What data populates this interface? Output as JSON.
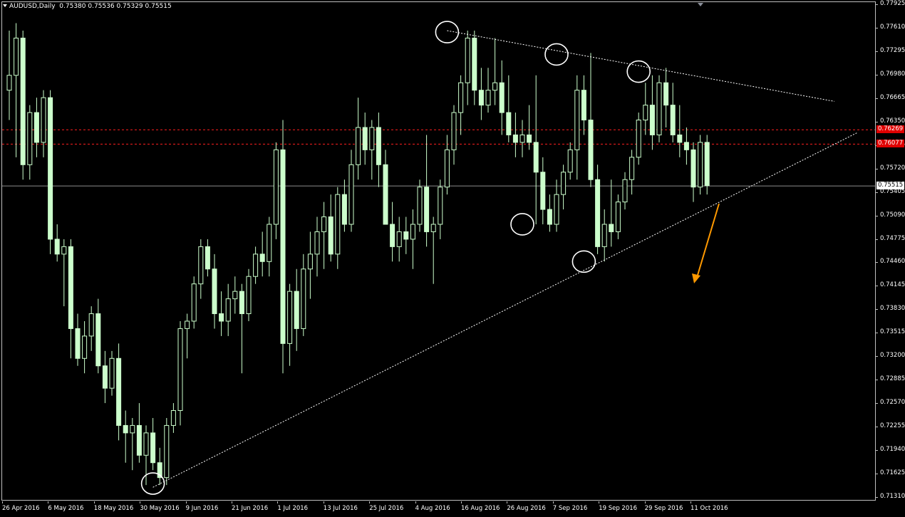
{
  "header": {
    "symbol": "AUDUSD,Daily",
    "ohlc": "0.75380 0.75536 0.75329 0.75515"
  },
  "colors": {
    "background": "#000000",
    "bull_candle": "#000000",
    "candle_outline": "#ccffcc",
    "current_price_line": "#8c8c8c",
    "resistance_lines": "#ff2020",
    "trendlines": "#ffffff",
    "arrow": "#ff9900",
    "badge_red": "#e00000"
  },
  "price_axis": {
    "labels": [
      "0.77925",
      "0.77610",
      "0.77295",
      "0.76980",
      "0.76665",
      "0.76350",
      "0.76035",
      "0.75720",
      "0.75405",
      "0.75090",
      "0.74775",
      "0.74460",
      "0.74145",
      "0.73830",
      "0.73515",
      "0.73200",
      "0.72885",
      "0.72570",
      "0.72255",
      "0.71940",
      "0.71625",
      "0.71310"
    ],
    "current_price": "0.75515",
    "red_levels": [
      "0.76269",
      "0.76077"
    ]
  },
  "time_axis": {
    "labels": [
      "26 Apr 2016",
      "6 May 2016",
      "18 May 2016",
      "30 May 2016",
      "9 Jun 2016",
      "21 Jun 2016",
      "1 Jul 2016",
      "13 Jul 2016",
      "25 Jul 2016",
      "4 Aug 2016",
      "16 Aug 2016",
      "26 Aug 2016",
      "7 Sep 2016",
      "19 Sep 2016",
      "29 Sep 2016",
      "11 Oct 2016"
    ]
  },
  "chart_data": {
    "type": "candlestick",
    "y_range": [
      0.7131,
      0.7797
    ],
    "candles": [
      [
        0.768,
        0.776,
        0.764,
        0.77
      ],
      [
        0.77,
        0.777,
        0.759,
        0.775
      ],
      [
        0.775,
        0.776,
        0.756,
        0.758
      ],
      [
        0.758,
        0.766,
        0.756,
        0.765
      ],
      [
        0.765,
        0.767,
        0.759,
        0.761
      ],
      [
        0.761,
        0.768,
        0.759,
        0.767
      ],
      [
        0.767,
        0.768,
        0.746,
        0.748
      ],
      [
        0.748,
        0.75,
        0.745,
        0.746
      ],
      [
        0.746,
        0.748,
        0.739,
        0.747
      ],
      [
        0.747,
        0.748,
        0.732,
        0.736
      ],
      [
        0.736,
        0.738,
        0.731,
        0.732
      ],
      [
        0.732,
        0.737,
        0.73,
        0.735
      ],
      [
        0.735,
        0.739,
        0.733,
        0.738
      ],
      [
        0.738,
        0.74,
        0.73,
        0.731
      ],
      [
        0.731,
        0.733,
        0.726,
        0.728
      ],
      [
        0.728,
        0.733,
        0.727,
        0.732
      ],
      [
        0.732,
        0.734,
        0.721,
        0.723
      ],
      [
        0.723,
        0.725,
        0.718,
        0.722
      ],
      [
        0.722,
        0.724,
        0.717,
        0.723
      ],
      [
        0.723,
        0.726,
        0.718,
        0.719
      ],
      [
        0.719,
        0.723,
        0.715,
        0.722
      ],
      [
        0.722,
        0.724,
        0.717,
        0.718
      ],
      [
        0.718,
        0.72,
        0.715,
        0.716
      ],
      [
        0.716,
        0.724,
        0.715,
        0.723
      ],
      [
        0.723,
        0.726,
        0.722,
        0.725
      ],
      [
        0.725,
        0.737,
        0.723,
        0.736
      ],
      [
        0.736,
        0.738,
        0.732,
        0.737
      ],
      [
        0.737,
        0.743,
        0.736,
        0.742
      ],
      [
        0.742,
        0.748,
        0.74,
        0.747
      ],
      [
        0.747,
        0.748,
        0.743,
        0.744
      ],
      [
        0.744,
        0.746,
        0.736,
        0.738
      ],
      [
        0.738,
        0.741,
        0.735,
        0.737
      ],
      [
        0.737,
        0.742,
        0.735,
        0.74
      ],
      [
        0.74,
        0.743,
        0.738,
        0.741
      ],
      [
        0.741,
        0.742,
        0.73,
        0.738
      ],
      [
        0.738,
        0.744,
        0.737,
        0.743
      ],
      [
        0.743,
        0.747,
        0.742,
        0.746
      ],
      [
        0.746,
        0.749,
        0.743,
        0.745
      ],
      [
        0.745,
        0.751,
        0.743,
        0.75
      ],
      [
        0.75,
        0.761,
        0.748,
        0.76
      ],
      [
        0.76,
        0.764,
        0.73,
        0.734
      ],
      [
        0.734,
        0.742,
        0.731,
        0.741
      ],
      [
        0.741,
        0.744,
        0.733,
        0.736
      ],
      [
        0.736,
        0.746,
        0.735,
        0.744
      ],
      [
        0.744,
        0.749,
        0.74,
        0.746
      ],
      [
        0.746,
        0.751,
        0.743,
        0.749
      ],
      [
        0.749,
        0.753,
        0.744,
        0.751
      ],
      [
        0.751,
        0.754,
        0.745,
        0.746
      ],
      [
        0.746,
        0.755,
        0.744,
        0.754
      ],
      [
        0.754,
        0.756,
        0.749,
        0.75
      ],
      [
        0.75,
        0.76,
        0.749,
        0.758
      ],
      [
        0.758,
        0.767,
        0.756,
        0.763
      ],
      [
        0.763,
        0.765,
        0.758,
        0.76
      ],
      [
        0.76,
        0.764,
        0.756,
        0.763
      ],
      [
        0.763,
        0.765,
        0.755,
        0.758
      ],
      [
        0.758,
        0.76,
        0.75,
        0.75
      ],
      [
        0.75,
        0.753,
        0.745,
        0.747
      ],
      [
        0.747,
        0.751,
        0.745,
        0.749
      ],
      [
        0.749,
        0.751,
        0.746,
        0.748
      ],
      [
        0.748,
        0.752,
        0.744,
        0.75
      ],
      [
        0.75,
        0.756,
        0.749,
        0.755
      ],
      [
        0.755,
        0.762,
        0.747,
        0.749
      ],
      [
        0.749,
        0.751,
        0.742,
        0.75
      ],
      [
        0.75,
        0.756,
        0.748,
        0.755
      ],
      [
        0.755,
        0.762,
        0.754,
        0.76
      ],
      [
        0.76,
        0.766,
        0.758,
        0.765
      ],
      [
        0.765,
        0.77,
        0.762,
        0.769
      ],
      [
        0.769,
        0.776,
        0.766,
        0.775
      ],
      [
        0.775,
        0.776,
        0.766,
        0.768
      ],
      [
        0.768,
        0.771,
        0.764,
        0.766
      ],
      [
        0.766,
        0.771,
        0.765,
        0.768
      ],
      [
        0.768,
        0.775,
        0.766,
        0.769
      ],
      [
        0.769,
        0.772,
        0.762,
        0.765
      ],
      [
        0.765,
        0.77,
        0.761,
        0.762
      ],
      [
        0.762,
        0.765,
        0.759,
        0.761
      ],
      [
        0.761,
        0.764,
        0.759,
        0.762
      ],
      [
        0.762,
        0.766,
        0.76,
        0.761
      ],
      [
        0.761,
        0.77,
        0.75,
        0.757
      ],
      [
        0.757,
        0.759,
        0.75,
        0.752
      ],
      [
        0.752,
        0.754,
        0.749,
        0.75
      ],
      [
        0.75,
        0.756,
        0.749,
        0.754
      ],
      [
        0.754,
        0.758,
        0.752,
        0.757
      ],
      [
        0.757,
        0.761,
        0.756,
        0.76
      ],
      [
        0.76,
        0.77,
        0.756,
        0.768
      ],
      [
        0.768,
        0.77,
        0.762,
        0.764
      ],
      [
        0.764,
        0.773,
        0.755,
        0.756
      ],
      [
        0.756,
        0.758,
        0.746,
        0.747
      ],
      [
        0.747,
        0.752,
        0.745,
        0.75
      ],
      [
        0.75,
        0.756,
        0.747,
        0.749
      ],
      [
        0.749,
        0.754,
        0.748,
        0.753
      ],
      [
        0.753,
        0.757,
        0.752,
        0.756
      ],
      [
        0.756,
        0.76,
        0.754,
        0.759
      ],
      [
        0.759,
        0.765,
        0.758,
        0.764
      ],
      [
        0.764,
        0.769,
        0.762,
        0.766
      ],
      [
        0.766,
        0.77,
        0.76,
        0.762
      ],
      [
        0.762,
        0.77,
        0.761,
        0.769
      ],
      [
        0.769,
        0.771,
        0.763,
        0.766
      ],
      [
        0.766,
        0.769,
        0.761,
        0.762
      ],
      [
        0.762,
        0.766,
        0.759,
        0.761
      ],
      [
        0.761,
        0.763,
        0.758,
        0.76
      ],
      [
        0.76,
        0.761,
        0.753,
        0.755
      ],
      [
        0.755,
        0.762,
        0.754,
        0.761
      ],
      [
        0.761,
        0.762,
        0.754,
        0.7552
      ]
    ],
    "trendlines": [
      {
        "name": "upper-resistance-trendline",
        "points": [
          [
            0.776,
            0.776
          ],
          [
            0.767,
            0.767
          ]
        ]
      },
      {
        "name": "lower-support-trendline",
        "points": [
          [
            0.7147,
            0.7147
          ],
          [
            0.7622,
            0.7622
          ]
        ]
      }
    ]
  }
}
